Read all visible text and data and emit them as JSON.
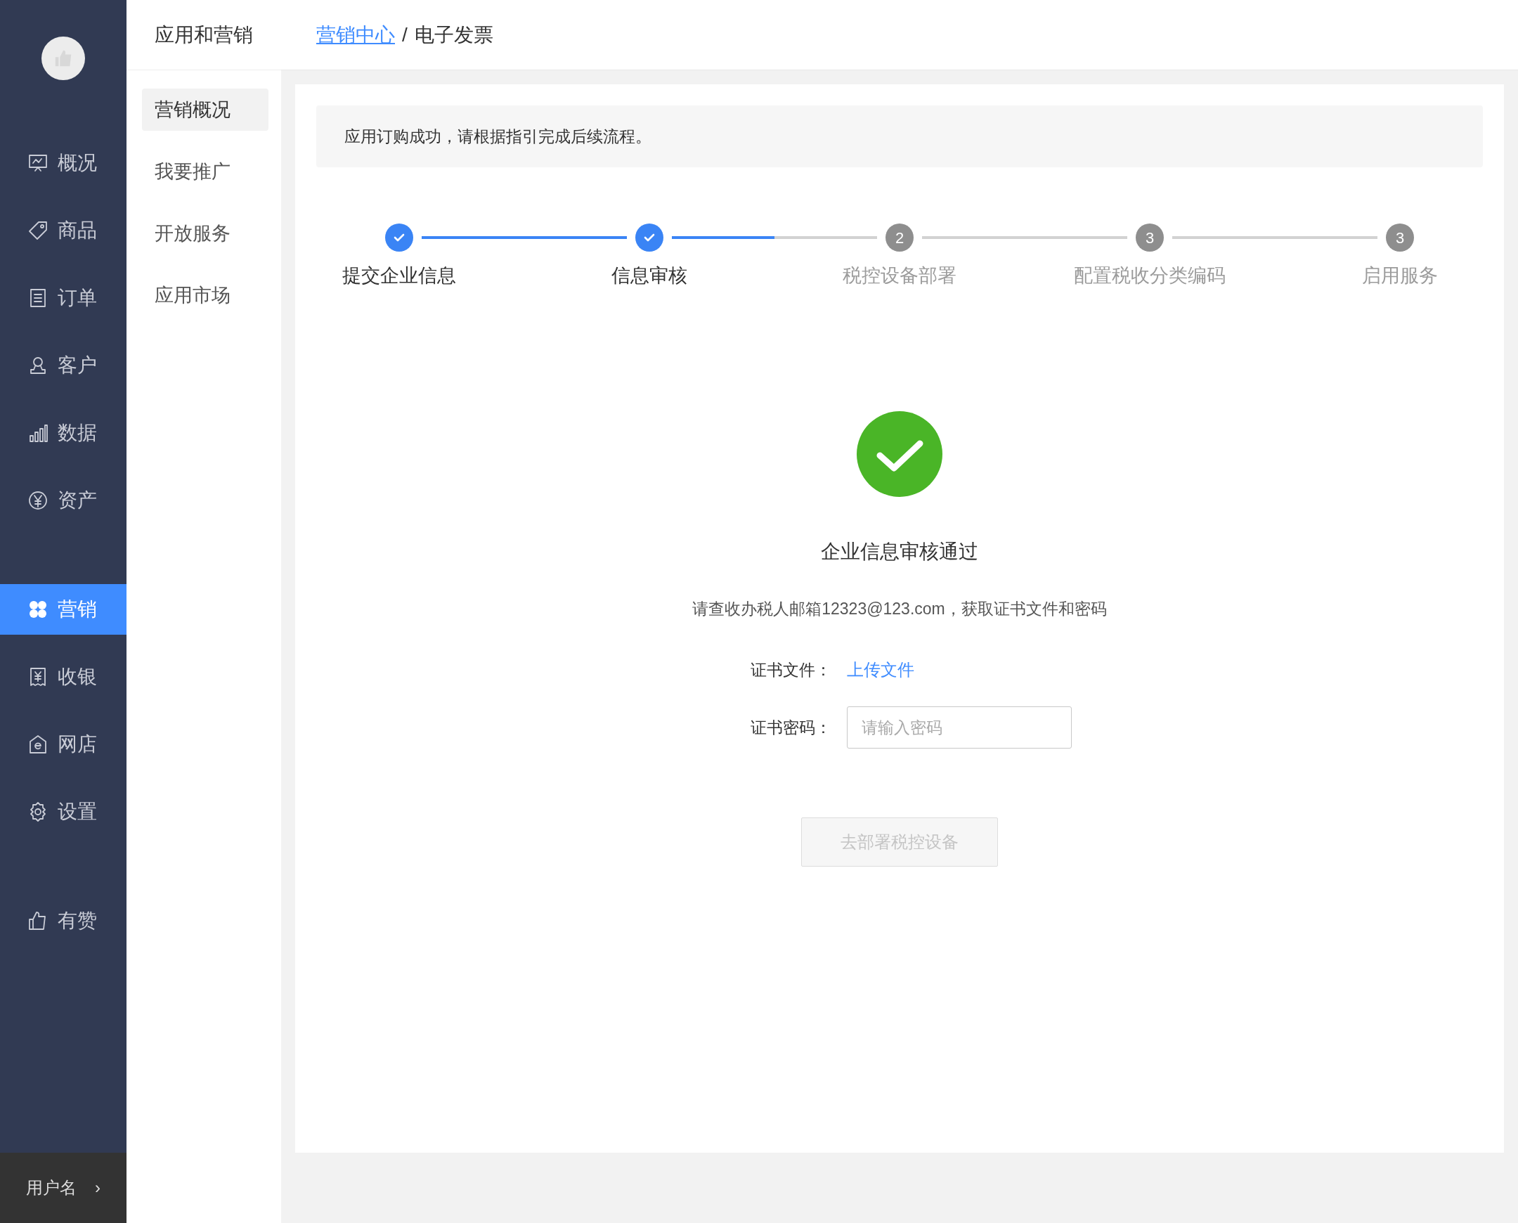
{
  "sidebar": {
    "groups": [
      {
        "items": [
          {
            "label": "概况",
            "kind": "monitor",
            "selected": false
          },
          {
            "label": "商品",
            "kind": "tag",
            "selected": false
          },
          {
            "label": "订单",
            "kind": "list",
            "selected": false
          },
          {
            "label": "客户",
            "kind": "user",
            "selected": false
          },
          {
            "label": "数据",
            "kind": "chart",
            "selected": false
          },
          {
            "label": "资产",
            "kind": "yen",
            "selected": false
          }
        ]
      },
      {
        "items": [
          {
            "label": "营销",
            "kind": "apps",
            "selected": true
          },
          {
            "label": "收银",
            "kind": "receipt",
            "selected": false
          },
          {
            "label": "网店",
            "kind": "shop",
            "selected": false
          },
          {
            "label": "设置",
            "kind": "gear",
            "selected": false
          }
        ]
      },
      {
        "items": [
          {
            "label": "有赞",
            "kind": "thumb",
            "selected": false
          }
        ]
      }
    ],
    "footer": {
      "username": "用户名",
      "arrow": "›"
    }
  },
  "subnav": {
    "title": "应用和营销",
    "items": [
      {
        "label": "营销概况",
        "selected": true
      },
      {
        "label": "我要推广",
        "selected": false
      },
      {
        "label": "开放服务",
        "selected": false
      },
      {
        "label": "应用市场",
        "selected": false
      }
    ]
  },
  "breadcrumb": {
    "items": [
      {
        "label": "营销中心",
        "link": true
      },
      {
        "label": "电子发票",
        "link": false
      }
    ],
    "separator": "/"
  },
  "alert": "应用订购成功，请根据指引完成后续流程。",
  "steps": [
    {
      "label": "提交企业信息",
      "done": true,
      "level": 1
    },
    {
      "label": "信息审核",
      "done": true,
      "level": 0.5
    },
    {
      "label": "税控设备部署",
      "done": false,
      "number": "2",
      "level": 0
    },
    {
      "label": "配置税收分类编码",
      "done": false,
      "number": "3",
      "level": 0
    },
    {
      "label": "启用服务",
      "done": false,
      "number": "3"
    }
  ],
  "result": {
    "title": "企业信息审核通过",
    "description": "请查收办税人邮箱12323@123.com，获取证书文件和密码",
    "fields": [
      {
        "kind": "link",
        "label": "证书文件：",
        "value": "上传文件"
      },
      {
        "kind": "input",
        "label": "证书密码：",
        "placeholder": "请输入密码"
      }
    ],
    "button": {
      "label": "去部署税控设备",
      "disabled": true
    }
  }
}
